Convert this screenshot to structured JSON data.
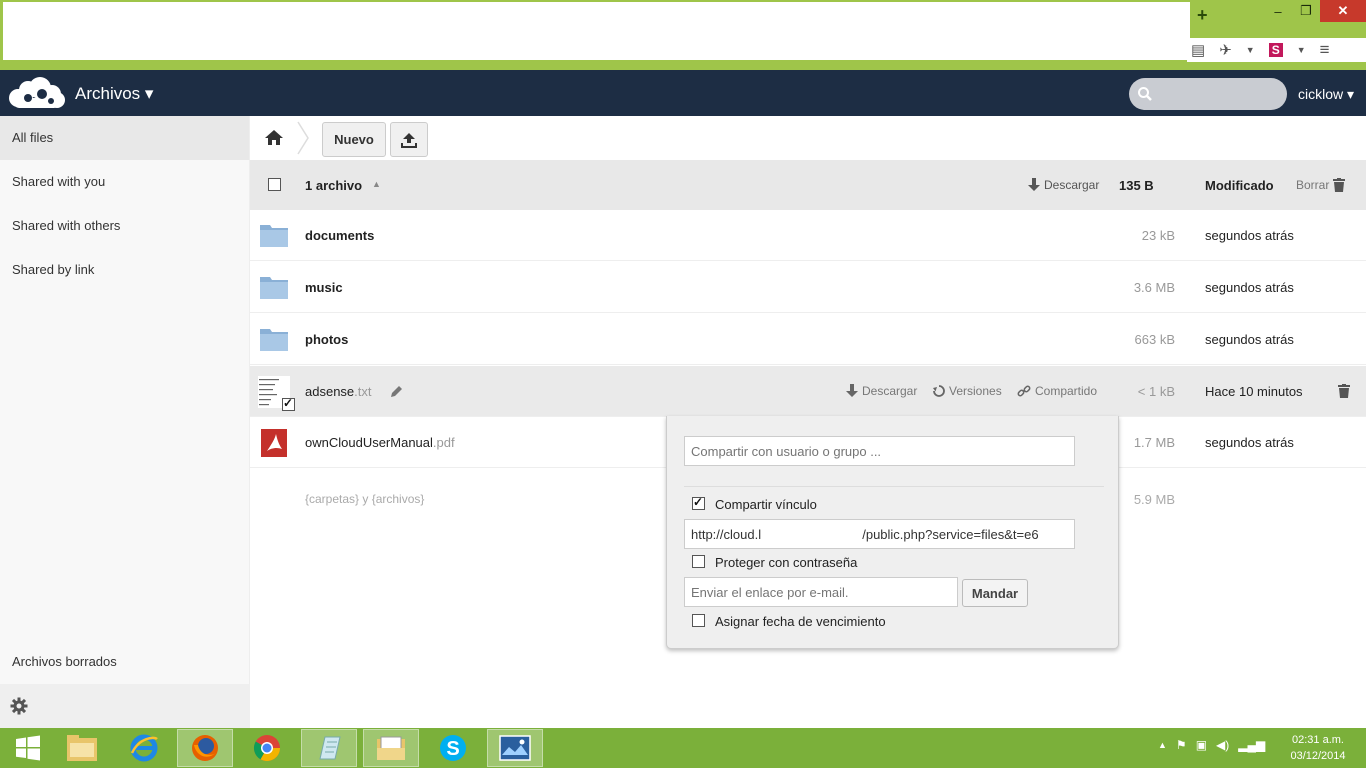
{
  "browser": {
    "new_tab": "+",
    "minimize": "–",
    "restore": "❐",
    "close": "✕"
  },
  "header": {
    "app_name": "Archivos ▾",
    "user": "cicklow ▾",
    "search_placeholder": ""
  },
  "sidebar": {
    "items": [
      {
        "label": "All files"
      },
      {
        "label": "Shared with you"
      },
      {
        "label": "Shared with others"
      },
      {
        "label": "Shared by link"
      }
    ],
    "trash": "Archivos borrados"
  },
  "controls": {
    "new_label": "Nuevo"
  },
  "list_header": {
    "count": "1 archivo",
    "sort_icon": "▲",
    "download": "Descargar",
    "size": "135 B",
    "modified": "Modificado",
    "delete": "Borrar"
  },
  "files": [
    {
      "name": "documents",
      "ext": "",
      "size": "23 kB",
      "modified": "segundos atrás"
    },
    {
      "name": "music",
      "ext": "",
      "size": "3.6 MB",
      "modified": "segundos atrás"
    },
    {
      "name": "photos",
      "ext": "",
      "size": "663 kB",
      "modified": "segundos atrás"
    },
    {
      "name": "adsense",
      "ext": ".txt",
      "size": "< 1 kB",
      "modified": "Hace 10 minutos",
      "actions": {
        "download": "Descargar",
        "versions": "Versiones",
        "shared": "Compartido"
      }
    },
    {
      "name": "ownCloudUserManual",
      "ext": ".pdf",
      "size": "1.7 MB",
      "modified": "segundos atrás"
    }
  ],
  "summary": {
    "text": "{carpetas} y {archivos}",
    "size": "5.9 MB"
  },
  "share": {
    "with_placeholder": "Compartir con usuario o grupo ...",
    "link_label": "Compartir vínculo",
    "link_url": "http://cloud.l                            /public.php?service=files&t=e6",
    "password_label": "Proteger con contraseña",
    "email_placeholder": "Enviar el enlace por e-mail.",
    "send_label": "Mandar",
    "expire_label": "Asignar fecha de vencimiento"
  },
  "taskbar": {
    "time": "02:31 a.m.",
    "date": "03/12/2014"
  }
}
